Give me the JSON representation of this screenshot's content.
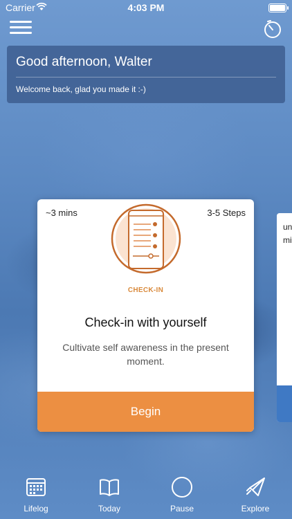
{
  "status_bar": {
    "carrier": "Carrier",
    "time": "4:03 PM"
  },
  "header": {
    "menu_icon": "hamburger-menu-icon",
    "timer_icon": "timer-icon"
  },
  "greeting": {
    "title": "Good afternoon, Walter",
    "subtitle": "Welcome back, glad you made it :-)"
  },
  "card": {
    "duration": "~3 mins",
    "steps": "3-5 Steps",
    "badge": "CHECK-IN",
    "title": "Check-in with yourself",
    "description": "Cultivate self awareness in the present moment.",
    "button": "Begin",
    "accent_color": "#ec8f42",
    "illustration_icon": "phone-checklist-icon"
  },
  "next_card_peek": {
    "text_line1": "un",
    "text_line2": "mi",
    "accent_color": "#3f79c4"
  },
  "tabbar": {
    "items": [
      {
        "label": "Lifelog",
        "icon": "calendar-grid-icon"
      },
      {
        "label": "Today",
        "icon": "open-book-icon"
      },
      {
        "label": "Pause",
        "icon": "circle-icon"
      },
      {
        "label": "Explore",
        "icon": "paper-plane-icon"
      }
    ]
  }
}
